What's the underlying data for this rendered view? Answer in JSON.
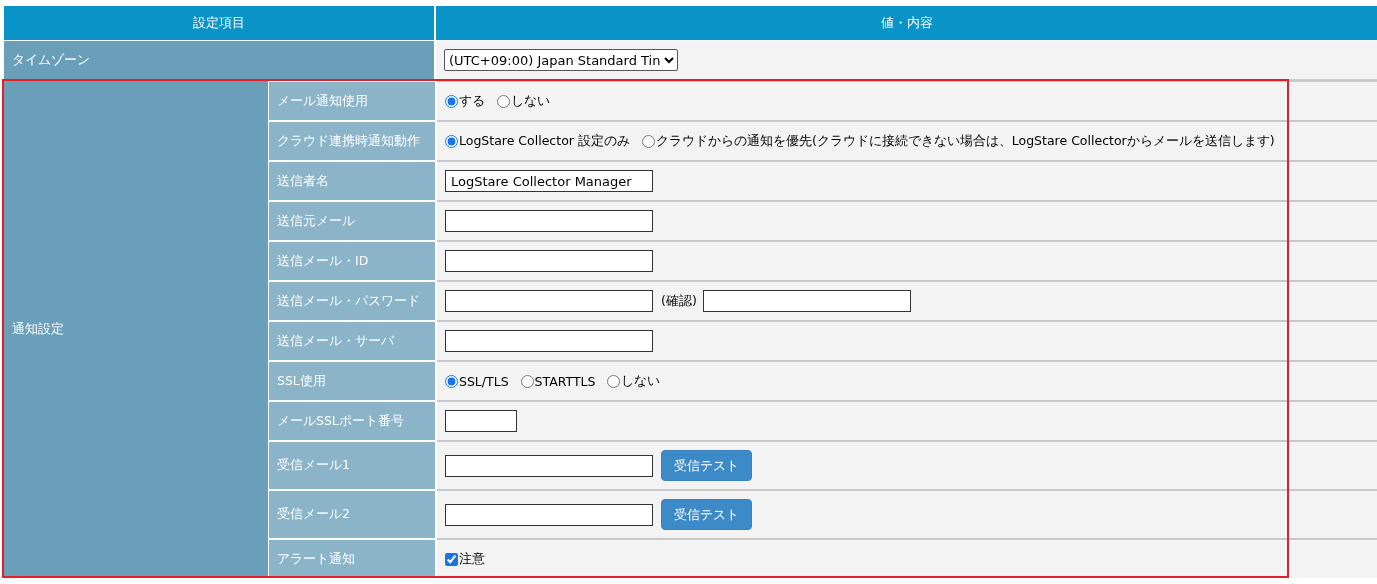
{
  "header": {
    "column_1": "設定項目",
    "column_2": "値・内容"
  },
  "timezone": {
    "label": "タイムゾーン",
    "value": "(UTC+09:00) Japan Standard Tin"
  },
  "group": {
    "label": "通知設定",
    "highlighted": true,
    "rows": [
      {
        "label": "メール通知使用",
        "items": [
          {
            "kind": "radio",
            "label": "する",
            "selected": true
          },
          {
            "kind": "radio",
            "label": "しない",
            "selected": false
          }
        ]
      },
      {
        "label": "クラウド連携時通知動作",
        "items": [
          {
            "kind": "radio",
            "label": "LogStare Collector 設定のみ",
            "selected": true
          },
          {
            "kind": "radio",
            "label": "クラウドからの通知を優先(クラウドに接続できない場合は、LogStare Collectorからメールを送信します)",
            "selected": false
          }
        ]
      },
      {
        "label": "送信者名",
        "items": [
          {
            "kind": "field",
            "value": "LogStare Collector Manager"
          }
        ]
      },
      {
        "label": "送信元メール",
        "items": [
          {
            "kind": "field"
          }
        ]
      },
      {
        "label": "送信メール・ID",
        "items": [
          {
            "kind": "field"
          }
        ]
      },
      {
        "label": "送信メール・パスワード",
        "items": [
          {
            "kind": "field"
          },
          {
            "kind": "note",
            "text": "(確認)"
          },
          {
            "kind": "field"
          }
        ]
      },
      {
        "label": "送信メール・サーバ",
        "items": [
          {
            "kind": "field"
          }
        ]
      },
      {
        "label": "SSL使用",
        "items": [
          {
            "kind": "radio",
            "label": "SSL/TLS",
            "selected": true
          },
          {
            "kind": "radio",
            "label": "STARTTLS",
            "selected": false
          },
          {
            "kind": "radio",
            "label": "しない",
            "selected": false
          }
        ]
      },
      {
        "label": "メールSSLポート番号",
        "items": [
          {
            "kind": "short_field"
          }
        ]
      },
      {
        "label": "受信メール1",
        "items": [
          {
            "kind": "field"
          },
          {
            "kind": "button",
            "label": "受信テスト"
          }
        ]
      },
      {
        "label": "受信メール2",
        "items": [
          {
            "kind": "field"
          },
          {
            "kind": "button",
            "label": "受信テスト"
          }
        ]
      },
      {
        "label": "アラート通知",
        "items": [
          {
            "kind": "checkbox",
            "label": "注意",
            "checked": true
          }
        ]
      }
    ]
  }
}
